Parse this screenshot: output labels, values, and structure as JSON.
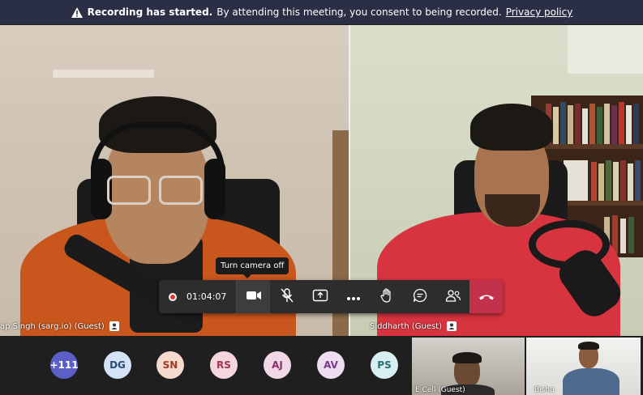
{
  "banner": {
    "bold": "Recording has started.",
    "text": "By attending this meeting, you consent to being recorded.",
    "link": "Privacy policy"
  },
  "tiles": [
    {
      "name": "ap Singh (sarg.io) (Guest)"
    },
    {
      "name": "Siddharth (Guest)"
    }
  ],
  "tooltip": "Turn camera off",
  "controls": {
    "timer": "01:04:07",
    "buttons": [
      "camera-icon",
      "mic-off-icon",
      "share-icon",
      "more-icon",
      "raise-hand-icon",
      "chat-icon",
      "people-icon",
      "hangup-icon"
    ]
  },
  "participants": [
    {
      "initials": "+111",
      "bg": "#5b5fc7",
      "fg": "#ffffff"
    },
    {
      "initials": "DG",
      "bg": "#d3e2f5",
      "fg": "#2b4a77"
    },
    {
      "initials": "SN",
      "bg": "#f6d9cf",
      "fg": "#9b3b22"
    },
    {
      "initials": "RS",
      "bg": "#f6d5dd",
      "fg": "#a3324e"
    },
    {
      "initials": "AJ",
      "bg": "#f0d8e6",
      "fg": "#8a3068"
    },
    {
      "initials": "AV",
      "bg": "#eedcf0",
      "fg": "#7a3a8a"
    },
    {
      "initials": "PS",
      "bg": "#d7eff0",
      "fg": "#246f74"
    }
  ],
  "thumbs": [
    {
      "label": "E Cell (Guest)"
    },
    {
      "label": "Bisha"
    }
  ]
}
